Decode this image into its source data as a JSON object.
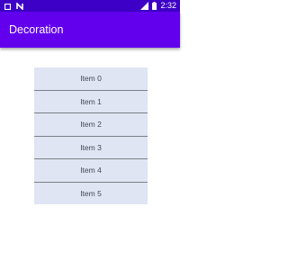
{
  "status_bar": {
    "time": "2:32",
    "icons": [
      "square-notification-icon",
      "n-app-icon",
      "signal-icon",
      "battery-icon"
    ]
  },
  "app_bar": {
    "title": "Decoration",
    "color": "#6200ee",
    "status_color": "#3d00c7"
  },
  "list": {
    "background": "#dfe5f2",
    "items": [
      {
        "label": "Item 0"
      },
      {
        "label": "Item 1"
      },
      {
        "label": "Item 2"
      },
      {
        "label": "Item 3"
      },
      {
        "label": "Item 4"
      },
      {
        "label": "Item 5"
      }
    ]
  }
}
